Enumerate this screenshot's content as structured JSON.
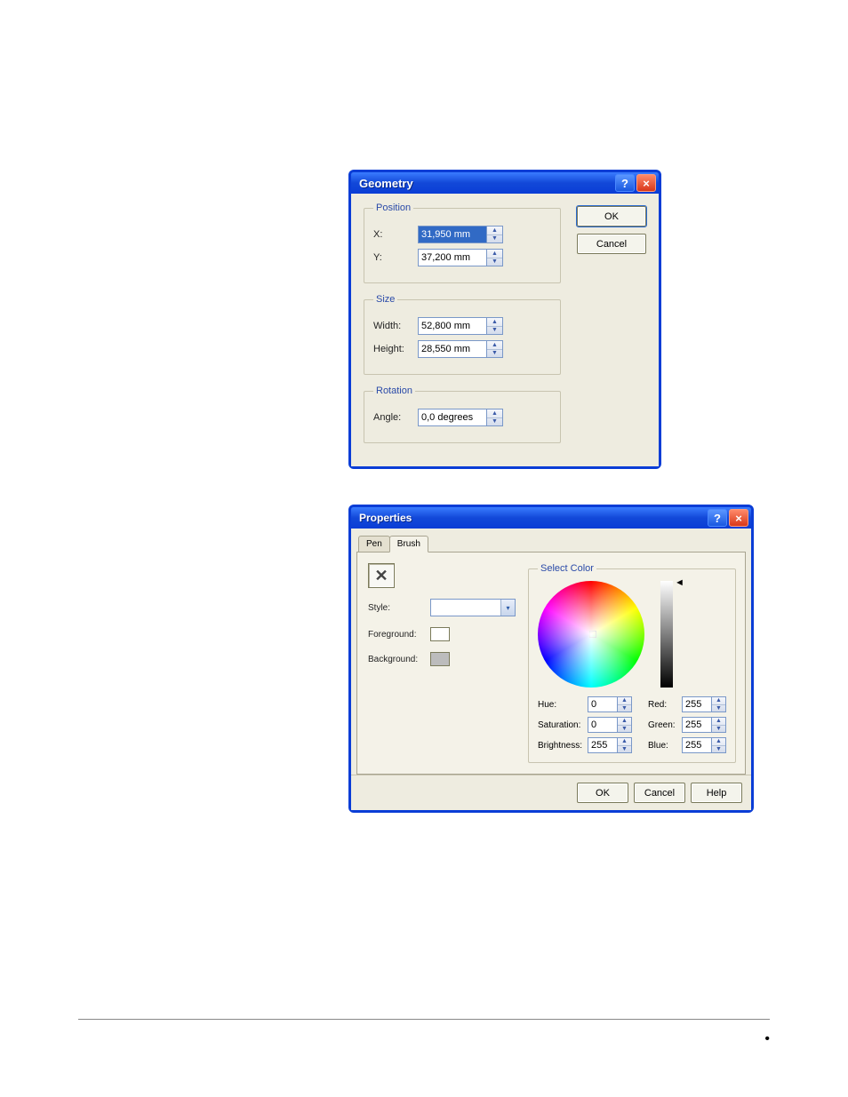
{
  "geometry": {
    "title": "Geometry",
    "groups": {
      "position": {
        "legend": "Position",
        "x_label": "X:",
        "x_value": "31,950 mm",
        "y_label": "Y:",
        "y_value": "37,200 mm"
      },
      "size": {
        "legend": "Size",
        "width_label": "Width:",
        "width_value": "52,800 mm",
        "height_label": "Height:",
        "height_value": "28,550 mm"
      },
      "rotation": {
        "legend": "Rotation",
        "angle_label": "Angle:",
        "angle_value": "0,0 degrees"
      }
    },
    "ok": "OK",
    "cancel": "Cancel"
  },
  "properties": {
    "title": "Properties",
    "tabs": {
      "pen": "Pen",
      "brush": "Brush"
    },
    "brush": {
      "style_label": "Style:",
      "foreground_label": "Foreground:",
      "background_label": "Background:",
      "fg_color": "#ffffff",
      "bg_color": "#bcbcbc"
    },
    "select_color": {
      "legend": "Select Color",
      "hue_label": "Hue:",
      "hue_value": "0",
      "sat_label": "Saturation:",
      "sat_value": "0",
      "bri_label": "Brightness:",
      "bri_value": "255",
      "red_label": "Red:",
      "red_value": "255",
      "green_label": "Green:",
      "green_value": "255",
      "blue_label": "Blue:",
      "blue_value": "255"
    },
    "ok": "OK",
    "cancel": "Cancel",
    "help": "Help"
  },
  "glyphs": {
    "help": "?",
    "close": "×",
    "up": "▲",
    "down": "▼",
    "drop": "▾",
    "arrow_left": "◄"
  }
}
